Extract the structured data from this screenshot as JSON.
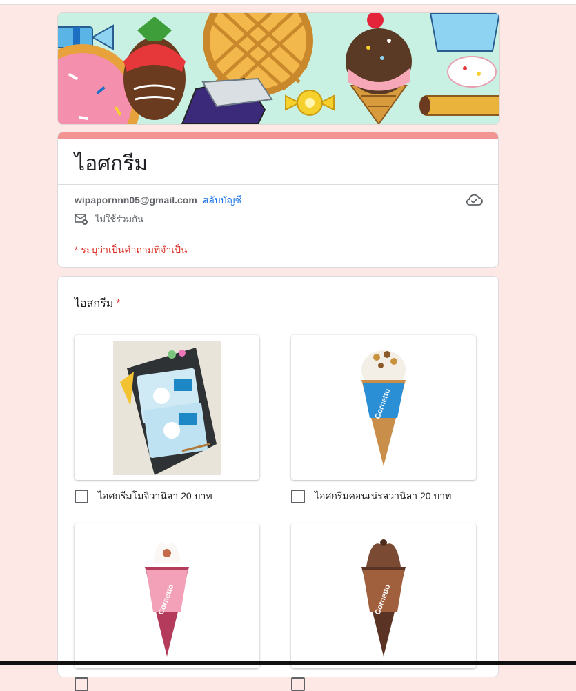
{
  "form": {
    "title": "ไอศกรีม",
    "account_email": "wipapornnn05@gmail.com",
    "switch_account": "สลับบัญชี",
    "not_shared": "ไม่ใช้ร่วมกัน",
    "required_note": "* ระบุว่าเป็นคำถามที่จำเป็น"
  },
  "question": {
    "title": "ไอสกรีม",
    "required_mark": "*",
    "options": [
      {
        "label": "ไอศกรีมโมจิวานิลา 20 บาท",
        "checked": false
      },
      {
        "label": "ไอศกรีมคอนเน่รสวานิลา 20 บาท",
        "checked": false
      },
      {
        "label": "",
        "checked": false
      },
      {
        "label": "",
        "checked": false
      }
    ]
  },
  "colors": {
    "page_bg": "#fde8e6",
    "accent": "#f29491",
    "link": "#1a73e8",
    "required": "#d93025"
  },
  "icons": {
    "cloud": "cloud-saved-icon",
    "mail": "mail-not-shared-icon"
  }
}
